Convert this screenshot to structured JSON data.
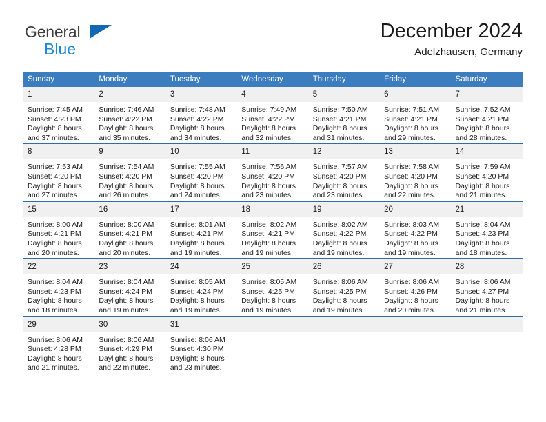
{
  "brand": {
    "name_part1": "General",
    "name_part2": "Blue",
    "mark": "triangle-logo"
  },
  "header": {
    "title": "December 2024",
    "subtitle": "Adelzhausen, Germany"
  },
  "calendar": {
    "weekday_headers": [
      "Sunday",
      "Monday",
      "Tuesday",
      "Wednesday",
      "Thursday",
      "Friday",
      "Saturday"
    ],
    "colors": {
      "header_background": "#3b7dbf",
      "header_text": "#ffffff",
      "daynum_background": "#f0f0f0",
      "row_divider": "#2f6ca8",
      "brand_blue": "#1e8ad6",
      "brand_mark_blue": "#1268b3",
      "text": "#1a1a1a"
    },
    "weeks": [
      [
        {
          "day": "1",
          "sunrise": "Sunrise: 7:45 AM",
          "sunset": "Sunset: 4:23 PM",
          "daylight_line1": "Daylight: 8 hours",
          "daylight_line2": "and 37 minutes."
        },
        {
          "day": "2",
          "sunrise": "Sunrise: 7:46 AM",
          "sunset": "Sunset: 4:22 PM",
          "daylight_line1": "Daylight: 8 hours",
          "daylight_line2": "and 35 minutes."
        },
        {
          "day": "3",
          "sunrise": "Sunrise: 7:48 AM",
          "sunset": "Sunset: 4:22 PM",
          "daylight_line1": "Daylight: 8 hours",
          "daylight_line2": "and 34 minutes."
        },
        {
          "day": "4",
          "sunrise": "Sunrise: 7:49 AM",
          "sunset": "Sunset: 4:22 PM",
          "daylight_line1": "Daylight: 8 hours",
          "daylight_line2": "and 32 minutes."
        },
        {
          "day": "5",
          "sunrise": "Sunrise: 7:50 AM",
          "sunset": "Sunset: 4:21 PM",
          "daylight_line1": "Daylight: 8 hours",
          "daylight_line2": "and 31 minutes."
        },
        {
          "day": "6",
          "sunrise": "Sunrise: 7:51 AM",
          "sunset": "Sunset: 4:21 PM",
          "daylight_line1": "Daylight: 8 hours",
          "daylight_line2": "and 29 minutes."
        },
        {
          "day": "7",
          "sunrise": "Sunrise: 7:52 AM",
          "sunset": "Sunset: 4:21 PM",
          "daylight_line1": "Daylight: 8 hours",
          "daylight_line2": "and 28 minutes."
        }
      ],
      [
        {
          "day": "8",
          "sunrise": "Sunrise: 7:53 AM",
          "sunset": "Sunset: 4:20 PM",
          "daylight_line1": "Daylight: 8 hours",
          "daylight_line2": "and 27 minutes."
        },
        {
          "day": "9",
          "sunrise": "Sunrise: 7:54 AM",
          "sunset": "Sunset: 4:20 PM",
          "daylight_line1": "Daylight: 8 hours",
          "daylight_line2": "and 26 minutes."
        },
        {
          "day": "10",
          "sunrise": "Sunrise: 7:55 AM",
          "sunset": "Sunset: 4:20 PM",
          "daylight_line1": "Daylight: 8 hours",
          "daylight_line2": "and 24 minutes."
        },
        {
          "day": "11",
          "sunrise": "Sunrise: 7:56 AM",
          "sunset": "Sunset: 4:20 PM",
          "daylight_line1": "Daylight: 8 hours",
          "daylight_line2": "and 23 minutes."
        },
        {
          "day": "12",
          "sunrise": "Sunrise: 7:57 AM",
          "sunset": "Sunset: 4:20 PM",
          "daylight_line1": "Daylight: 8 hours",
          "daylight_line2": "and 23 minutes."
        },
        {
          "day": "13",
          "sunrise": "Sunrise: 7:58 AM",
          "sunset": "Sunset: 4:20 PM",
          "daylight_line1": "Daylight: 8 hours",
          "daylight_line2": "and 22 minutes."
        },
        {
          "day": "14",
          "sunrise": "Sunrise: 7:59 AM",
          "sunset": "Sunset: 4:20 PM",
          "daylight_line1": "Daylight: 8 hours",
          "daylight_line2": "and 21 minutes."
        }
      ],
      [
        {
          "day": "15",
          "sunrise": "Sunrise: 8:00 AM",
          "sunset": "Sunset: 4:21 PM",
          "daylight_line1": "Daylight: 8 hours",
          "daylight_line2": "and 20 minutes."
        },
        {
          "day": "16",
          "sunrise": "Sunrise: 8:00 AM",
          "sunset": "Sunset: 4:21 PM",
          "daylight_line1": "Daylight: 8 hours",
          "daylight_line2": "and 20 minutes."
        },
        {
          "day": "17",
          "sunrise": "Sunrise: 8:01 AM",
          "sunset": "Sunset: 4:21 PM",
          "daylight_line1": "Daylight: 8 hours",
          "daylight_line2": "and 19 minutes."
        },
        {
          "day": "18",
          "sunrise": "Sunrise: 8:02 AM",
          "sunset": "Sunset: 4:21 PM",
          "daylight_line1": "Daylight: 8 hours",
          "daylight_line2": "and 19 minutes."
        },
        {
          "day": "19",
          "sunrise": "Sunrise: 8:02 AM",
          "sunset": "Sunset: 4:22 PM",
          "daylight_line1": "Daylight: 8 hours",
          "daylight_line2": "and 19 minutes."
        },
        {
          "day": "20",
          "sunrise": "Sunrise: 8:03 AM",
          "sunset": "Sunset: 4:22 PM",
          "daylight_line1": "Daylight: 8 hours",
          "daylight_line2": "and 19 minutes."
        },
        {
          "day": "21",
          "sunrise": "Sunrise: 8:04 AM",
          "sunset": "Sunset: 4:23 PM",
          "daylight_line1": "Daylight: 8 hours",
          "daylight_line2": "and 18 minutes."
        }
      ],
      [
        {
          "day": "22",
          "sunrise": "Sunrise: 8:04 AM",
          "sunset": "Sunset: 4:23 PM",
          "daylight_line1": "Daylight: 8 hours",
          "daylight_line2": "and 18 minutes."
        },
        {
          "day": "23",
          "sunrise": "Sunrise: 8:04 AM",
          "sunset": "Sunset: 4:24 PM",
          "daylight_line1": "Daylight: 8 hours",
          "daylight_line2": "and 19 minutes."
        },
        {
          "day": "24",
          "sunrise": "Sunrise: 8:05 AM",
          "sunset": "Sunset: 4:24 PM",
          "daylight_line1": "Daylight: 8 hours",
          "daylight_line2": "and 19 minutes."
        },
        {
          "day": "25",
          "sunrise": "Sunrise: 8:05 AM",
          "sunset": "Sunset: 4:25 PM",
          "daylight_line1": "Daylight: 8 hours",
          "daylight_line2": "and 19 minutes."
        },
        {
          "day": "26",
          "sunrise": "Sunrise: 8:06 AM",
          "sunset": "Sunset: 4:25 PM",
          "daylight_line1": "Daylight: 8 hours",
          "daylight_line2": "and 19 minutes."
        },
        {
          "day": "27",
          "sunrise": "Sunrise: 8:06 AM",
          "sunset": "Sunset: 4:26 PM",
          "daylight_line1": "Daylight: 8 hours",
          "daylight_line2": "and 20 minutes."
        },
        {
          "day": "28",
          "sunrise": "Sunrise: 8:06 AM",
          "sunset": "Sunset: 4:27 PM",
          "daylight_line1": "Daylight: 8 hours",
          "daylight_line2": "and 21 minutes."
        }
      ],
      [
        {
          "day": "29",
          "sunrise": "Sunrise: 8:06 AM",
          "sunset": "Sunset: 4:28 PM",
          "daylight_line1": "Daylight: 8 hours",
          "daylight_line2": "and 21 minutes."
        },
        {
          "day": "30",
          "sunrise": "Sunrise: 8:06 AM",
          "sunset": "Sunset: 4:29 PM",
          "daylight_line1": "Daylight: 8 hours",
          "daylight_line2": "and 22 minutes."
        },
        {
          "day": "31",
          "sunrise": "Sunrise: 8:06 AM",
          "sunset": "Sunset: 4:30 PM",
          "daylight_line1": "Daylight: 8 hours",
          "daylight_line2": "and 23 minutes."
        },
        {
          "day": "",
          "sunrise": "",
          "sunset": "",
          "daylight_line1": "",
          "daylight_line2": ""
        },
        {
          "day": "",
          "sunrise": "",
          "sunset": "",
          "daylight_line1": "",
          "daylight_line2": ""
        },
        {
          "day": "",
          "sunrise": "",
          "sunset": "",
          "daylight_line1": "",
          "daylight_line2": ""
        },
        {
          "day": "",
          "sunrise": "",
          "sunset": "",
          "daylight_line1": "",
          "daylight_line2": ""
        }
      ]
    ]
  }
}
